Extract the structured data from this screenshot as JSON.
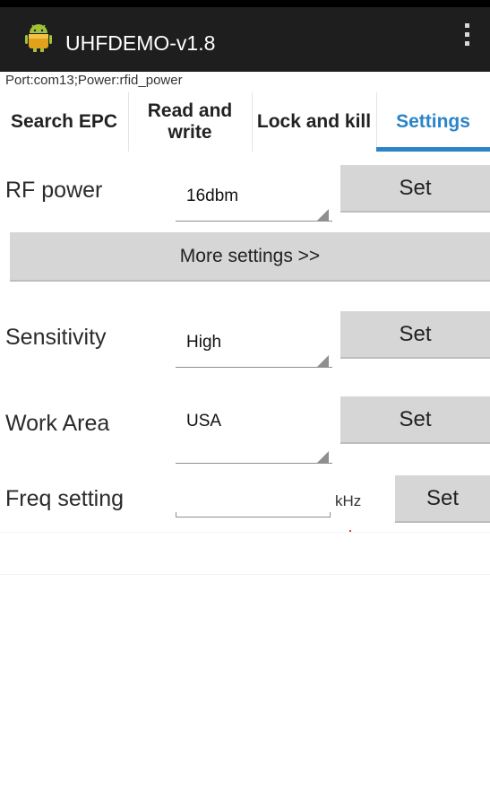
{
  "app": {
    "title": "UHFDEMO-v1.8",
    "icon": "android-robot-icon",
    "menu_icon": "overflow-menu-icon"
  },
  "status": {
    "port_line": "Port:com13;Power:rfid_power"
  },
  "tabs": [
    {
      "label": "Search EPC",
      "active": false
    },
    {
      "label": "Read and write",
      "active": false
    },
    {
      "label": "Lock and kill",
      "active": false
    },
    {
      "label": "Settings",
      "active": true
    }
  ],
  "settings": {
    "rf_power": {
      "label": "RF power",
      "value": "16dbm",
      "button": "Set"
    },
    "more_settings": {
      "label": "More settings >>"
    },
    "sensitivity": {
      "label": "Sensitivity",
      "value": "High",
      "button": "Set"
    },
    "work_area": {
      "label": "Work Area",
      "value": "USA",
      "button": "Set"
    },
    "freq": {
      "label": "Freq setting",
      "value": "",
      "unit": "kHz",
      "button": "Set"
    }
  },
  "colors": {
    "action_bar": "#1e1e1e",
    "accent": "#2a84c8",
    "button_bg": "#d6d6d6"
  }
}
